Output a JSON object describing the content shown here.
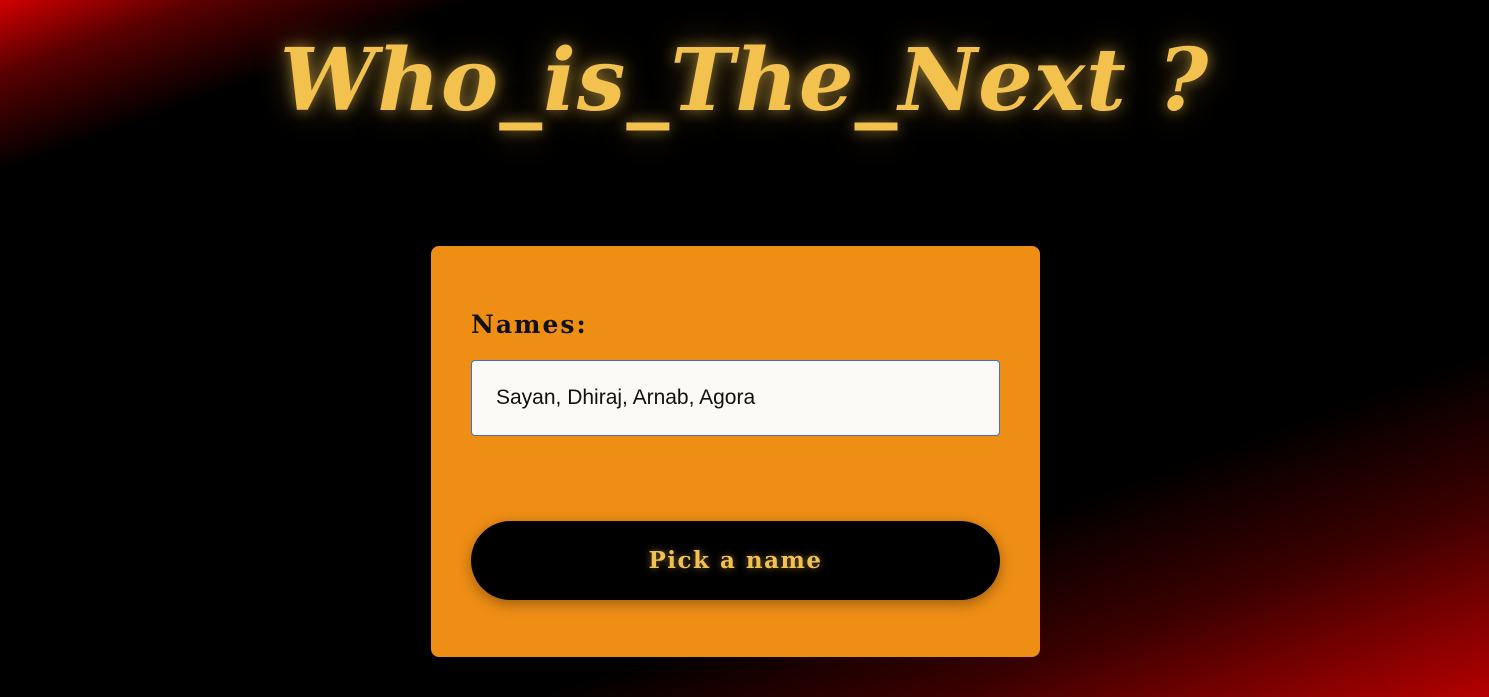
{
  "page": {
    "title": "Who_is_The_Next ?"
  },
  "form": {
    "names_label": "Names:",
    "names_value": "Sayan, Dhiraj, Arnab, Agora",
    "pick_button_label": "Pick a name"
  },
  "colors": {
    "accent_gold": "#f2c14e",
    "card_orange": "#ef8e15",
    "background_black": "#000000",
    "corner_red": "#d10000"
  }
}
